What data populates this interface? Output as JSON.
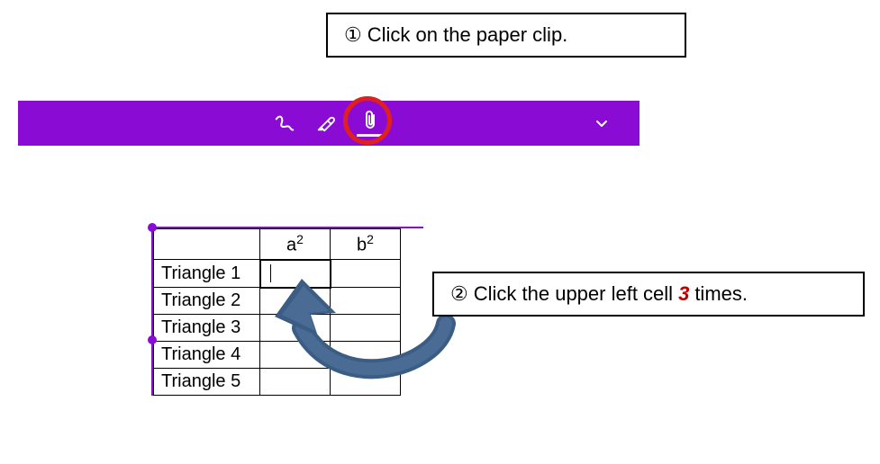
{
  "callouts": {
    "one_num": "①",
    "one_text": "Click on the paper clip.",
    "two_num": "②",
    "two_pre": "Click the upper left cell",
    "two_emph": "3",
    "two_post": "times."
  },
  "toolbar": {
    "icons": {
      "scribble": "scribble-icon",
      "highlighter": "highlighter-icon",
      "paperclip": "paperclip-icon",
      "chevron": "chevron-down-icon"
    }
  },
  "table": {
    "headers": {
      "h1": "",
      "h2": "a",
      "h2_sup": "2",
      "h3": "b",
      "h3_sup": "2"
    },
    "rows": [
      "Triangle 1",
      "Triangle 2",
      "Triangle 3",
      "Triangle 4",
      "Triangle 5"
    ]
  }
}
